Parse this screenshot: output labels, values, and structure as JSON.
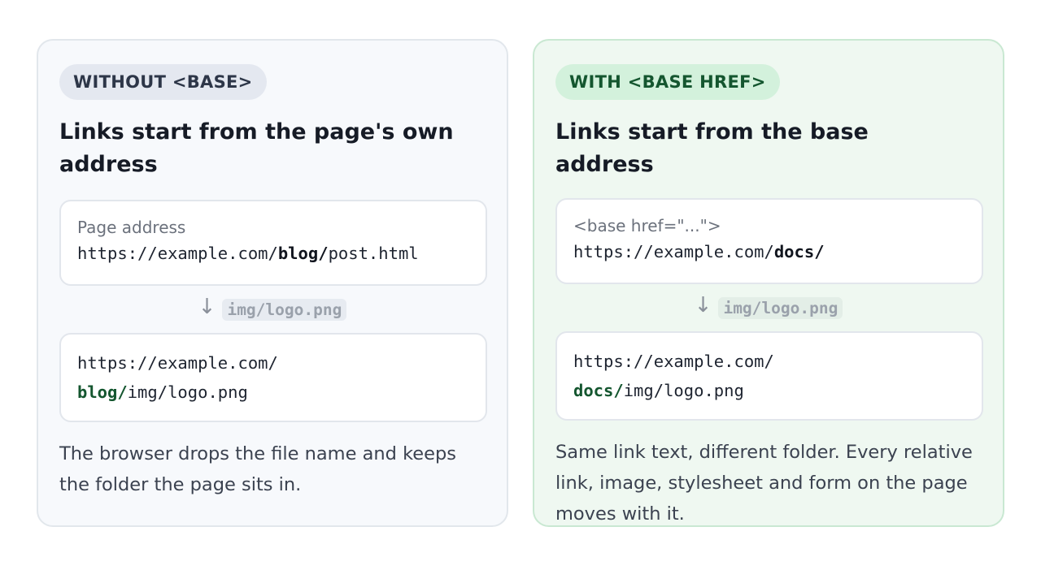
{
  "left": {
    "badge": "WITHOUT <BASE>",
    "heading": "Links start from the page's own address",
    "card1": {
      "label": "Page address",
      "url_prefix": "https://example.com/",
      "url_folder": "blog/",
      "url_suffix": "post.html"
    },
    "link": "img/logo.png",
    "card2": {
      "url_prefix": "https://example.com/",
      "url_folder": "blog/",
      "url_suffix": "img/logo.png"
    },
    "caption": "The browser drops the file name and keeps the folder the page sits in."
  },
  "right": {
    "badge": "WITH <BASE HREF>",
    "heading": "Links start from the base address",
    "card1": {
      "label": "<base href=\"...\">",
      "url_prefix": "https://example.com/",
      "url_folder": "docs/"
    },
    "link": "img/logo.png",
    "card2": {
      "url_prefix": "https://example.com/",
      "url_folder": "docs/",
      "url_suffix": "img/logo.png"
    },
    "caption": "Same link text, different folder. Every relative link, image, stylesheet and form on the page moves with it."
  },
  "icons": {
    "arrow": "arrow-down-icon"
  },
  "colors": {
    "left_panel_bg": "#f7f9fc",
    "right_panel_bg": "#eff8f1",
    "right_accent": "#14562f"
  }
}
